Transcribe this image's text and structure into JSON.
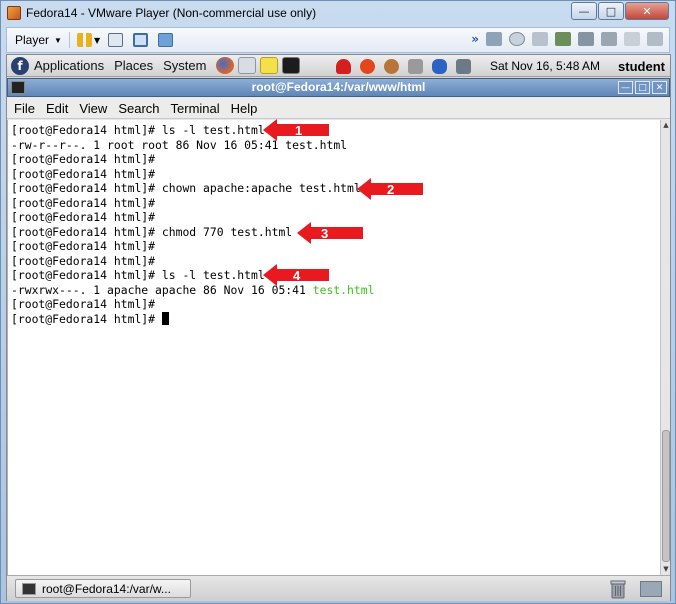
{
  "vm_window": {
    "title": "Fedora14 - VMware Player (Non-commercial use only)",
    "controls": [
      "minimize",
      "maximize",
      "close"
    ]
  },
  "vm_toolbar": {
    "player_menu": "Player",
    "icons": [
      "pause-icon",
      "send-ctrl-alt-del-icon",
      "fullscreen-icon",
      "unity-icon"
    ],
    "device_icons": [
      "forward-icon",
      "hdd-icon",
      "cdrom-icon",
      "floppy-icon",
      "network-icon",
      "printer-icon",
      "sound-icon",
      "usb-icon",
      "display-icon"
    ]
  },
  "gnome_panel": {
    "menus": [
      "Applications",
      "Places",
      "System"
    ],
    "clock": "Sat Nov 16,  5:48 AM",
    "user": "student"
  },
  "terminal": {
    "title": "root@Fedora14:/var/www/html",
    "menu": [
      "File",
      "Edit",
      "View",
      "Search",
      "Terminal",
      "Help"
    ],
    "lines": [
      "[root@Fedora14 html]# ls -l test.html",
      "-rw-r--r--. 1 root root 86 Nov 16 05:41 test.html",
      "[root@Fedora14 html]#",
      "[root@Fedora14 html]#",
      "[root@Fedora14 html]# chown apache:apache test.html",
      "[root@Fedora14 html]#",
      "[root@Fedora14 html]#",
      "[root@Fedora14 html]# chmod 770 test.html",
      "[root@Fedora14 html]#",
      "[root@Fedora14 html]#",
      "[root@Fedora14 html]# ls -l test.html",
      "-rwxrwx---. 1 apache apache 86 Nov 16 05:41 ",
      "[root@Fedora14 html]#",
      "[root@Fedora14 html]# "
    ],
    "green_filename": "test.html"
  },
  "annotations": {
    "arrow_labels": [
      "1",
      "2",
      "3",
      "4"
    ],
    "arrow_color": "#e8191f"
  },
  "taskbar": {
    "task_label": "root@Fedora14:/var/w..."
  }
}
